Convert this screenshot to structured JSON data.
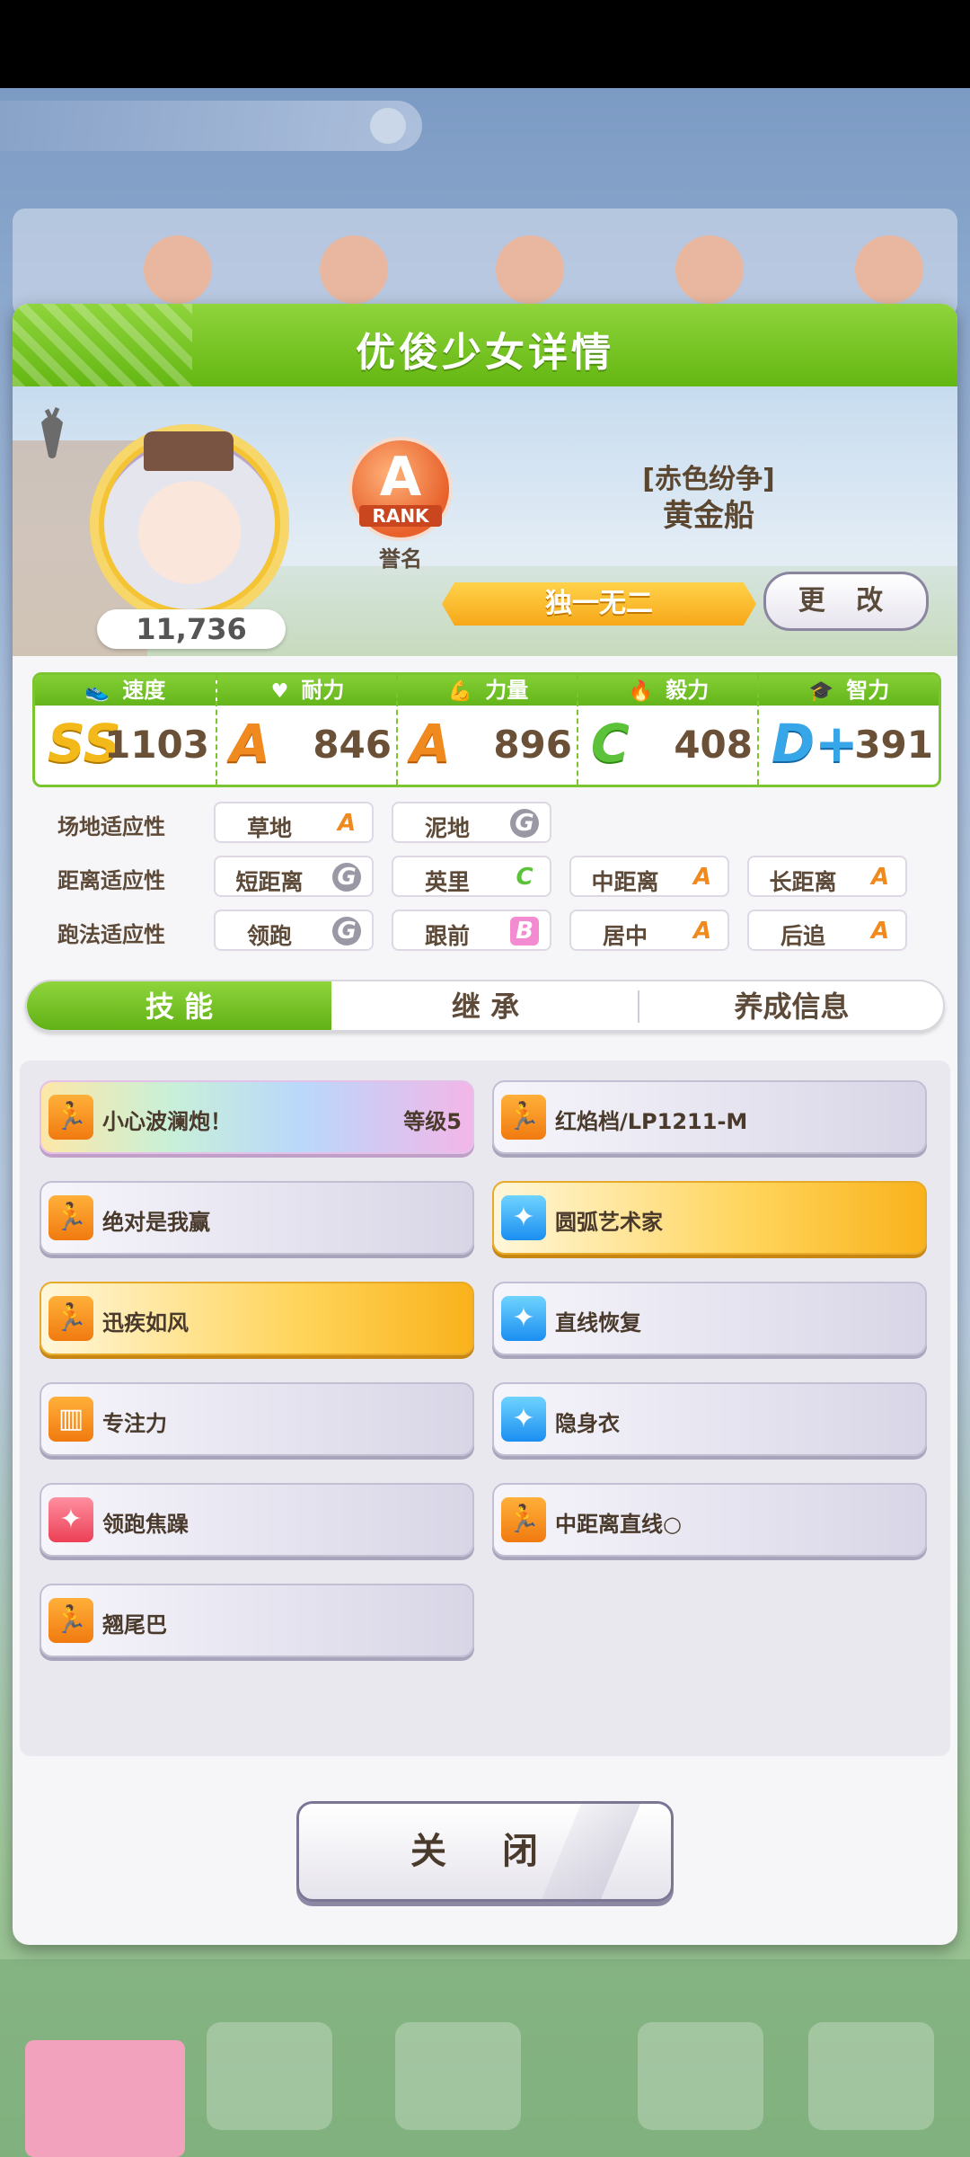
{
  "background": {
    "banner_text": "",
    "colors": {
      "accent_green": "#6cbc1c",
      "gold": "#f7a81a"
    }
  },
  "dialog": {
    "title": "优俊少女详情",
    "profile": {
      "score": "11,736",
      "rank_letter": "A",
      "rank_word": "RANK",
      "rank_label": "誉名",
      "epithet": "[赤色纷争]",
      "name": "黄金船",
      "title": "独一无二",
      "change_button": "更 改"
    },
    "stats": [
      {
        "label": "速度",
        "icon": "shoe-icon",
        "grade": "SS",
        "value": "1103"
      },
      {
        "label": "耐力",
        "icon": "heart-icon",
        "grade": "A",
        "value": "846"
      },
      {
        "label": "力量",
        "icon": "muscle-icon",
        "grade": "A",
        "value": "896"
      },
      {
        "label": "毅力",
        "icon": "flame-icon",
        "grade": "C",
        "value": "408"
      },
      {
        "label": "智力",
        "icon": "graduation-cap-icon",
        "grade": "D+",
        "value": "391"
      }
    ],
    "aptitudes": {
      "track": {
        "label": "场地适应性",
        "items": [
          {
            "name": "草地",
            "grade": "A"
          },
          {
            "name": "泥地",
            "grade": "G"
          }
        ]
      },
      "distance": {
        "label": "距离适应性",
        "items": [
          {
            "name": "短距离",
            "grade": "G"
          },
          {
            "name": "英里",
            "grade": "C"
          },
          {
            "name": "中距离",
            "grade": "A"
          },
          {
            "name": "长距离",
            "grade": "A"
          }
        ]
      },
      "style": {
        "label": "跑法适应性",
        "items": [
          {
            "name": "领跑",
            "grade": "G"
          },
          {
            "name": "跟前",
            "grade": "B"
          },
          {
            "name": "居中",
            "grade": "A"
          },
          {
            "name": "后追",
            "grade": "A"
          }
        ]
      }
    },
    "tabs": [
      {
        "label": "技 能",
        "active": true
      },
      {
        "label": "继 承",
        "active": false
      },
      {
        "label": "养成信息",
        "active": false
      }
    ],
    "skills": [
      {
        "name": "小心波澜炮！",
        "level": "等级5",
        "icon": "runner-icon"
      },
      {
        "name": "红焰档/LP1211-M",
        "level": "",
        "icon": "runner-icon"
      },
      {
        "name": "绝对是我赢",
        "level": "",
        "icon": "runner-icon"
      },
      {
        "name": "圆弧艺术家",
        "level": "",
        "icon": "sparkle-icon"
      },
      {
        "name": "迅疾如风",
        "level": "",
        "icon": "runner-icon"
      },
      {
        "name": "直线恢复",
        "level": "",
        "icon": "sparkle-icon"
      },
      {
        "name": "专注力",
        "level": "",
        "icon": "gate-icon"
      },
      {
        "name": "隐身衣",
        "level": "",
        "icon": "sparkle-icon"
      },
      {
        "name": "领跑焦躁",
        "level": "",
        "icon": "sparkle-icon"
      },
      {
        "name": "中距离直线○",
        "level": "",
        "icon": "runner-icon"
      },
      {
        "name": "翘尾巴",
        "level": "",
        "icon": "runner-icon"
      }
    ],
    "close_button": "关 闭"
  }
}
